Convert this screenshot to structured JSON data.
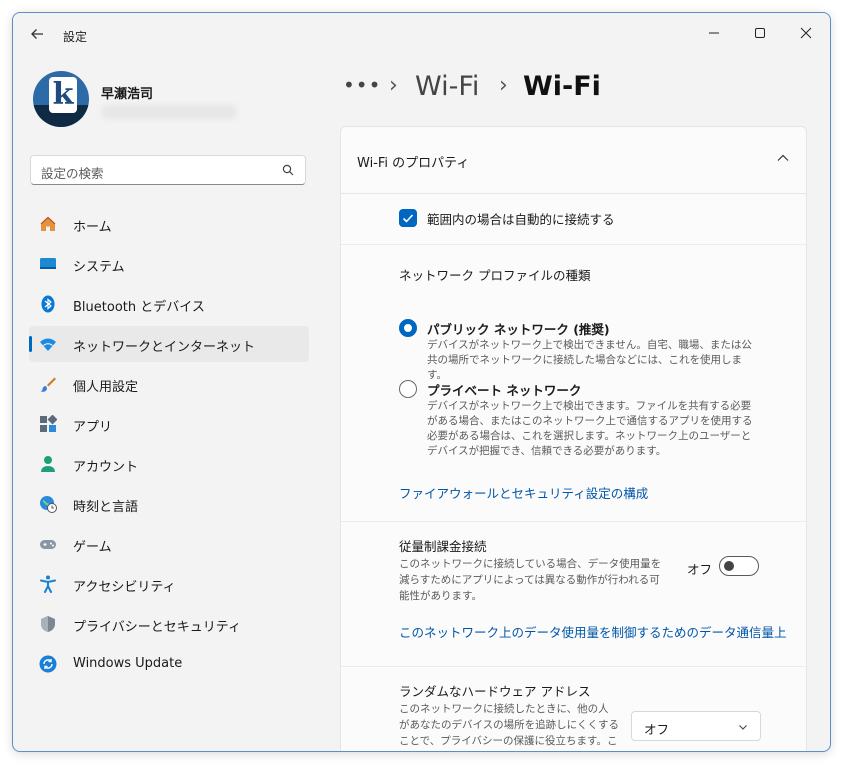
{
  "window": {
    "title": "設定"
  },
  "user": {
    "name": "早瀬浩司"
  },
  "search": {
    "placeholder": "設定の検索"
  },
  "nav": [
    {
      "label": "ホーム",
      "icon": "home-icon"
    },
    {
      "label": "システム",
      "icon": "system-icon"
    },
    {
      "label": "Bluetooth とデバイス",
      "icon": "bluetooth-icon"
    },
    {
      "label": "ネットワークとインターネット",
      "icon": "wifi-icon",
      "active": true
    },
    {
      "label": "個人用設定",
      "icon": "brush-icon"
    },
    {
      "label": "アプリ",
      "icon": "apps-icon"
    },
    {
      "label": "アカウント",
      "icon": "account-icon"
    },
    {
      "label": "時刻と言語",
      "icon": "globe-clock-icon"
    },
    {
      "label": "ゲーム",
      "icon": "gamepad-icon"
    },
    {
      "label": "アクセシビリティ",
      "icon": "accessibility-icon"
    },
    {
      "label": "プライバシーとセキュリティ",
      "icon": "shield-icon"
    },
    {
      "label": "Windows Update",
      "icon": "update-icon"
    }
  ],
  "breadcrumb": {
    "dots": "•••",
    "sep": "›",
    "parent": "Wi-Fi",
    "current": "Wi-Fi"
  },
  "card": {
    "title": "Wi-Fi のプロパティ",
    "auto_connect": {
      "label": "範囲内の場合は自動的に接続する",
      "checked": true
    },
    "profile": {
      "title": "ネットワーク プロファイルの種類",
      "public_label": "パブリック ネットワーク (推奨)",
      "public_desc": "デバイスがネットワーク上で検出できません。自宅、職場、または公共の場所でネットワークに接続した場合などには、これを使用します。",
      "private_label": "プライベート ネットワーク",
      "private_desc": "デバイスがネットワーク上で検出できます。ファイルを共有する必要がある場合、またはこのネットワーク上で通信するアプリを使用する必要がある場合は、これを選択します。ネットワーク上のユーザーとデバイスが把握でき、信頼できる必要があります。",
      "selected": "public",
      "firewall_link": "ファイアウォールとセキュリティ設定の構成"
    },
    "metered": {
      "title": "従量制課金接続",
      "desc": "このネットワークに接続している場合、データ使用量を減らすためにアプリによっては異なる動作が行われる可能性があります。",
      "toggle_label": "オフ",
      "on": false,
      "link": "このネットワーク上のデータ使用量を制御するためのデータ通信量上"
    },
    "random_mac": {
      "title": "ランダムなハードウェア アドレス",
      "desc": "このネットワークに接続したときに、他の人があなたのデバイスの場所を追跡しにくくすることで、プライバシーの保護に役立ちます。この設定は、次にこのネットワークに接続したときに有",
      "value": "オフ"
    }
  },
  "colors": {
    "accent": "#0067c0",
    "link": "#0056a8"
  }
}
